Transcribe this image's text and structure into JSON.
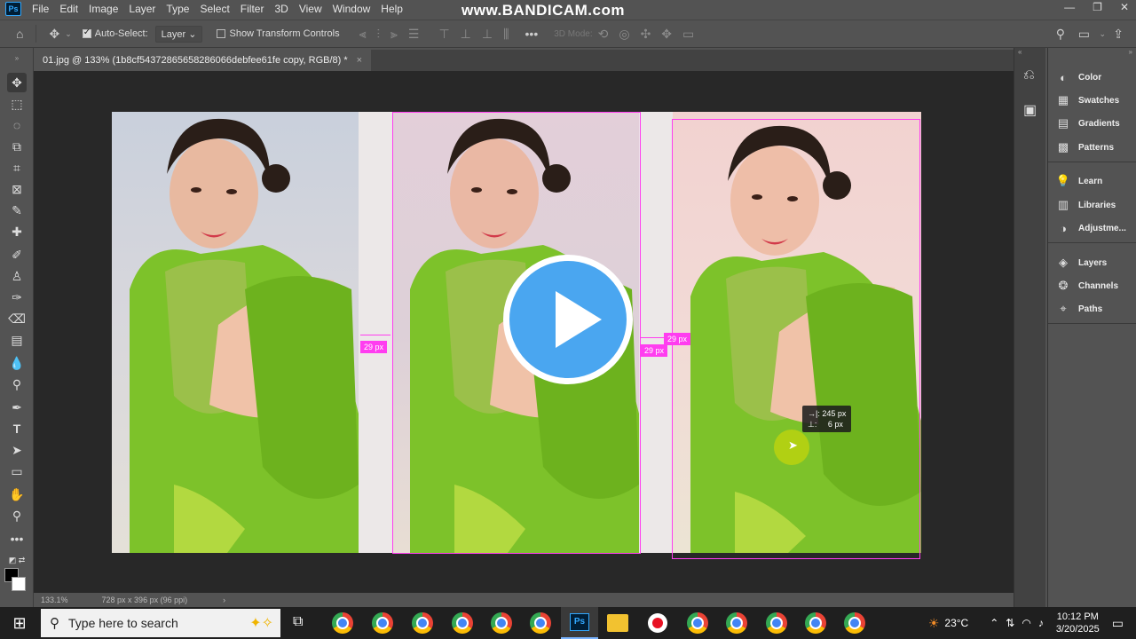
{
  "menubar": {
    "logo": "Ps",
    "items": [
      "File",
      "Edit",
      "Image",
      "Layer",
      "Type",
      "Select",
      "Filter",
      "3D",
      "View",
      "Window",
      "Help"
    ],
    "watermark": "www.BANDICAM.com",
    "window_controls": [
      "—",
      "❐",
      "✕"
    ]
  },
  "options": {
    "auto_select_label": "Auto-Select:",
    "auto_select_checked": true,
    "layer_select": "Layer",
    "transform_label": "Show Transform Controls",
    "transform_checked": false,
    "mode_3d": "3D Mode:"
  },
  "document": {
    "tab_title": "01.jpg @ 133% (1b8cf54372865658286066debfee61fe copy, RGB/8) *",
    "close": "×"
  },
  "canvas": {
    "spacing_labels": [
      "29 px",
      "29 px",
      "29 px"
    ],
    "readout_x": "245 px",
    "readout_y": "6 px",
    "x_label": "→|:",
    "y_label": "⊥:"
  },
  "status": {
    "zoom": "133.1%",
    "doc_size": "728 px x 396 px (96 ppi)",
    "arrow": "›"
  },
  "panels": {
    "group1": [
      "Color",
      "Swatches",
      "Gradients",
      "Patterns"
    ],
    "group2": [
      "Learn",
      "Libraries",
      "Adjustme..."
    ],
    "group3": [
      "Layers",
      "Channels",
      "Paths"
    ]
  },
  "taskbar": {
    "search_placeholder": "Type here to search",
    "weather": "23°C",
    "time": "10:12 PM",
    "date": "3/20/2025"
  },
  "colors": {
    "accent_guides": "#ff3df0",
    "play_button": "#4aa6f0",
    "fg_color": "#000000",
    "bg_color": "#ffffff"
  }
}
